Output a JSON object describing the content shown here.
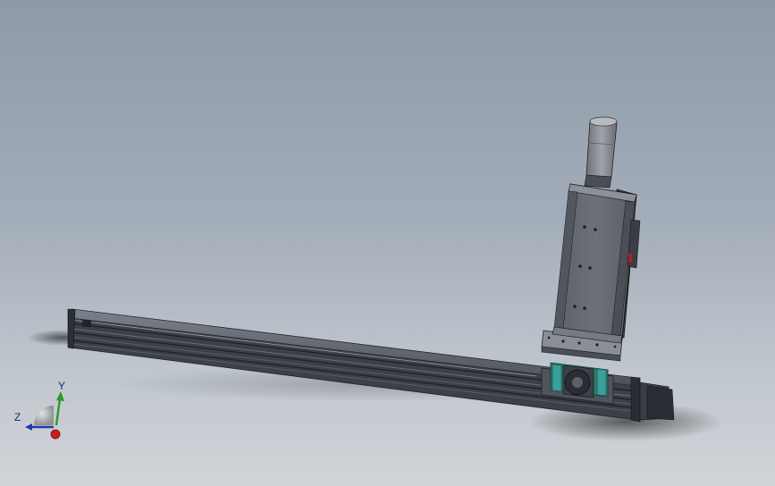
{
  "viewport": {
    "background_top": "#8e9aa8",
    "background_bottom": "#d0d4d8"
  },
  "model": {
    "parts": [
      "linear-rail-base",
      "carriage-mount",
      "vertical-slide-module",
      "servo-motor-vertical",
      "servo-motor-horizontal"
    ],
    "colors": {
      "rail": "#5a5f6a",
      "rail_dark": "#2f333a",
      "plate": "#6e727a",
      "motor": "#8a8e94",
      "teal": "#2e7f78"
    }
  },
  "triad": {
    "x_label": "",
    "y_label": "Y",
    "z_label": "Z",
    "x_color": "#c81e1e",
    "y_color": "#2a9a2a",
    "z_color": "#1e3aa8"
  }
}
